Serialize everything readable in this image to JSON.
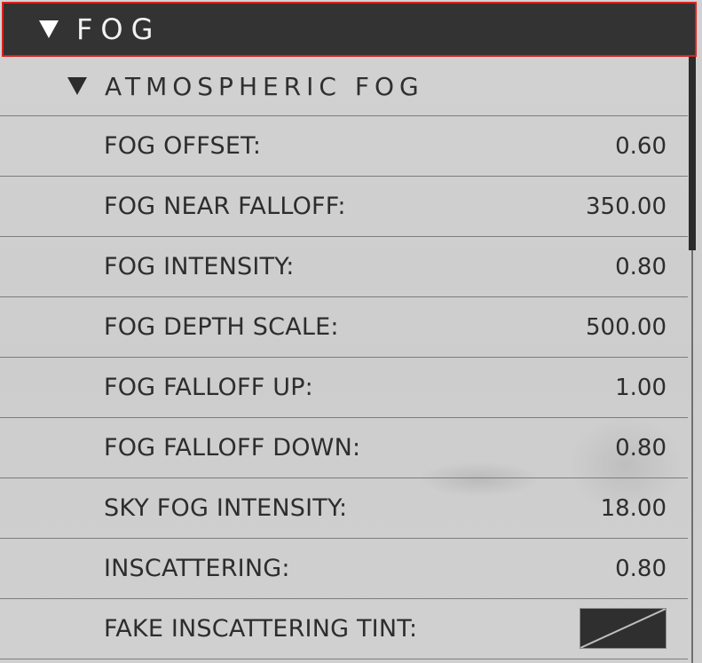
{
  "section": {
    "title": "FOG",
    "subsection": {
      "title": "ATMOSPHERIC FOG",
      "properties": [
        {
          "label": "FOG OFFSET:",
          "value": "0.60"
        },
        {
          "label": "FOG NEAR FALLOFF:",
          "value": "350.00"
        },
        {
          "label": "FOG INTENSITY:",
          "value": "0.80"
        },
        {
          "label": "FOG DEPTH SCALE:",
          "value": "500.00"
        },
        {
          "label": "FOG FALLOFF UP:",
          "value": "1.00"
        },
        {
          "label": "FOG FALLOFF DOWN:",
          "value": "0.80"
        },
        {
          "label": "SKY FOG INTENSITY:",
          "value": "18.00"
        },
        {
          "label": "INSCATTERING:",
          "value": "0.80"
        },
        {
          "label": "FAKE INSCATTERING TINT:",
          "swatch_color": "#2f2f2f"
        }
      ]
    }
  },
  "colors": {
    "header_bg": "#333333",
    "header_border": "#e02020",
    "panel_bg": "#cfcfcf",
    "text": "#2d2d2d"
  },
  "icons": {
    "expand": "triangle-down-icon"
  }
}
